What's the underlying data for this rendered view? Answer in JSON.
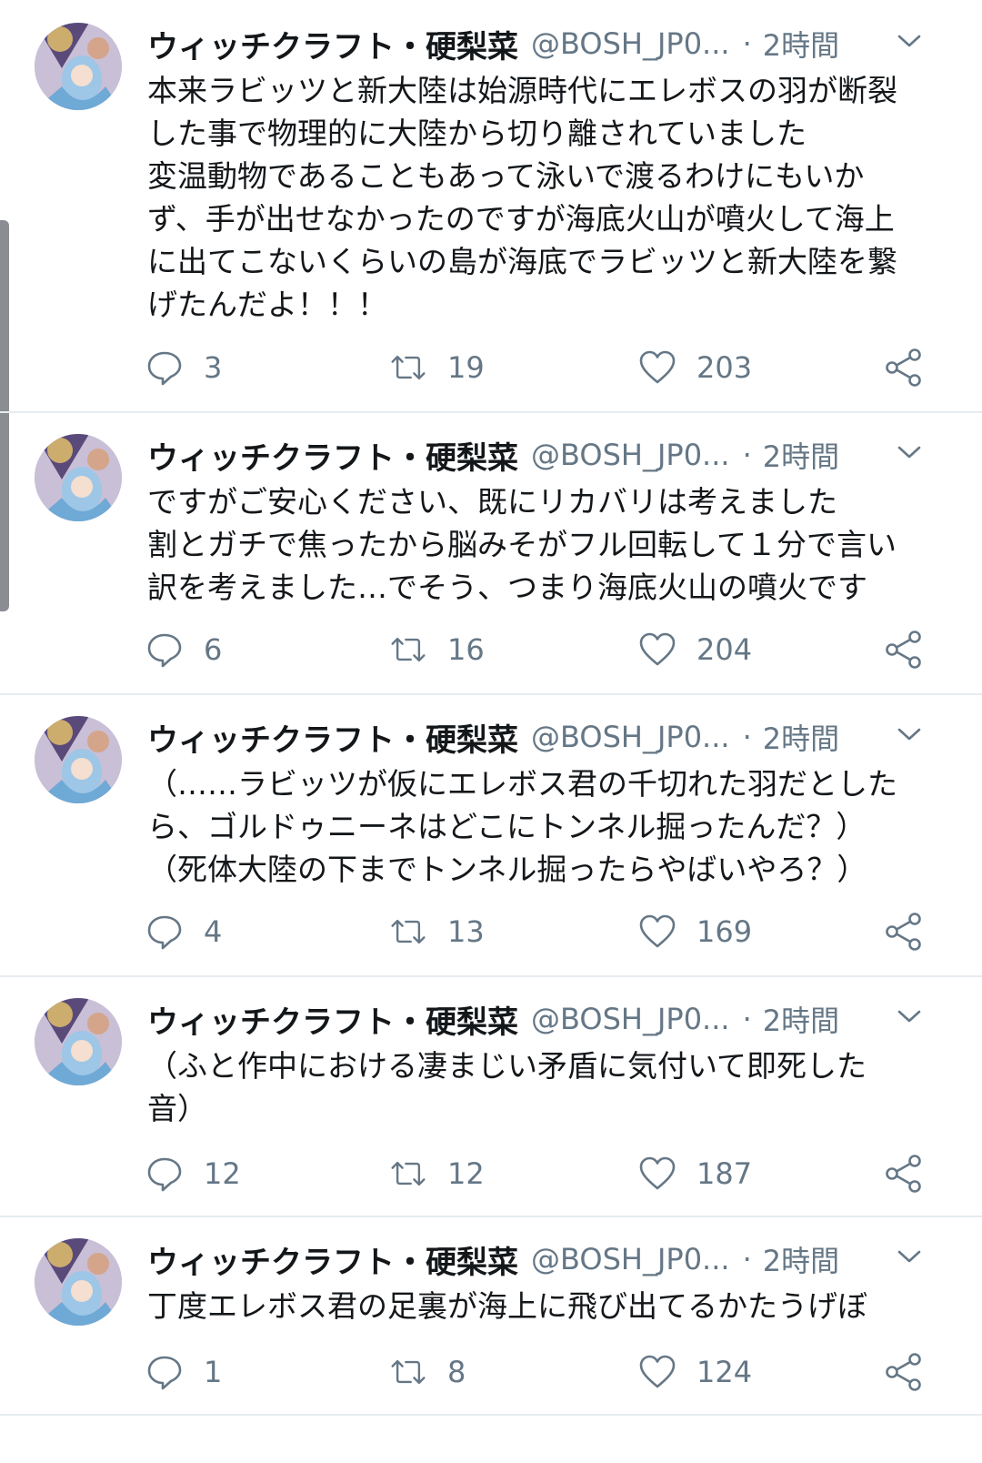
{
  "tweets": [
    {
      "name": "ウィッチクラフト・硬梨菜",
      "handle": "@BOSH_JP0...",
      "separator": "·",
      "time": "2時間",
      "text": "本来ラビッツと新大陸は始源時代にエレボスの羽が断裂\nした事で物理的に大陸から切り離されていました\n変温動物であることもあって泳いで渡るわけにもいか\nず、手が出せなかったのですが海底火山が噴火して海上\nに出てこないくらいの島が海底でラビッツと新大陸を繋\nげたんだよ！！！",
      "replies": "3",
      "retweets": "19",
      "likes": "203"
    },
    {
      "name": "ウィッチクラフト・硬梨菜",
      "handle": "@BOSH_JP0...",
      "separator": "·",
      "time": "2時間",
      "text": "ですがご安心ください、既にリカバリは考えました\n割とガチで焦ったから脳みそがフル回転して１分で言い\n訳を考えました…でそう、つまり海底火山の噴火です",
      "replies": "6",
      "retweets": "16",
      "likes": "204"
    },
    {
      "name": "ウィッチクラフト・硬梨菜",
      "handle": "@BOSH_JP0...",
      "separator": "·",
      "time": "2時間",
      "text": "（……ラビッツが仮にエレボス君の千切れた羽だとした\nら、ゴルドゥニーネはどこにトンネル掘ったんだ？）\n（死体大陸の下までトンネル掘ったらやばいやろ？）",
      "replies": "4",
      "retweets": "13",
      "likes": "169"
    },
    {
      "name": "ウィッチクラフト・硬梨菜",
      "handle": "@BOSH_JP0...",
      "separator": "·",
      "time": "2時間",
      "text": "（ふと作中における凄まじい矛盾に気付いて即死した\n音）",
      "replies": "12",
      "retweets": "12",
      "likes": "187"
    },
    {
      "name": "ウィッチクラフト・硬梨菜",
      "handle": "@BOSH_JP0...",
      "separator": "·",
      "time": "2時間",
      "text": "丁度エレボス君の足裏が海上に飛び出てるかたうげぼ",
      "replies": "1",
      "retweets": "8",
      "likes": "124"
    }
  ],
  "icons": {
    "reply": "reply-icon",
    "retweet": "retweet-icon",
    "like": "heart-icon",
    "share": "share-icon",
    "caret": "chevron-down-icon"
  },
  "colors": {
    "text": "#14171a",
    "secondary": "#657786",
    "divider": "#e6ecf0"
  }
}
